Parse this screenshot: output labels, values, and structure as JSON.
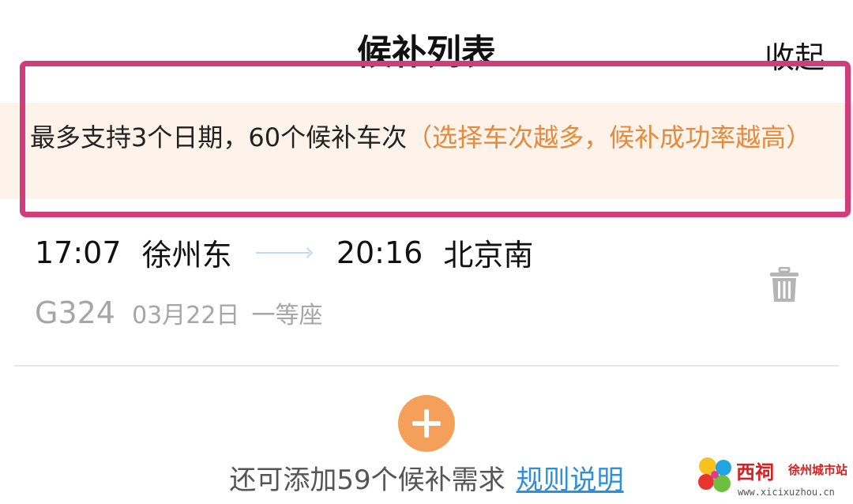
{
  "header": {
    "title": "候补列表",
    "collapse_label": "收起"
  },
  "notice": {
    "text_main": "最多支持3个日期，60个候补车次",
    "text_hint": "（选择车次越多，候补成功率越高）",
    "highlight_color": "#d33c7b",
    "hint_color": "#e58a3a"
  },
  "train": {
    "depart_time": "17:07",
    "depart_station": "徐州东",
    "arrive_time": "20:16",
    "arrive_station": "北京南",
    "train_no": "G324",
    "date": "03月22日",
    "seat": "一等座",
    "delete_icon": "trash-icon"
  },
  "footer": {
    "remaining": "还可添加59个候补需求",
    "rules_link": "规则说明",
    "add_icon": "plus-icon",
    "accent_color": "#f5a05a",
    "link_color": "#2f8fd8"
  },
  "watermark": {
    "name": "西祠",
    "sub": "徐州城市站",
    "url": "www.xicixuzhou.cn"
  }
}
